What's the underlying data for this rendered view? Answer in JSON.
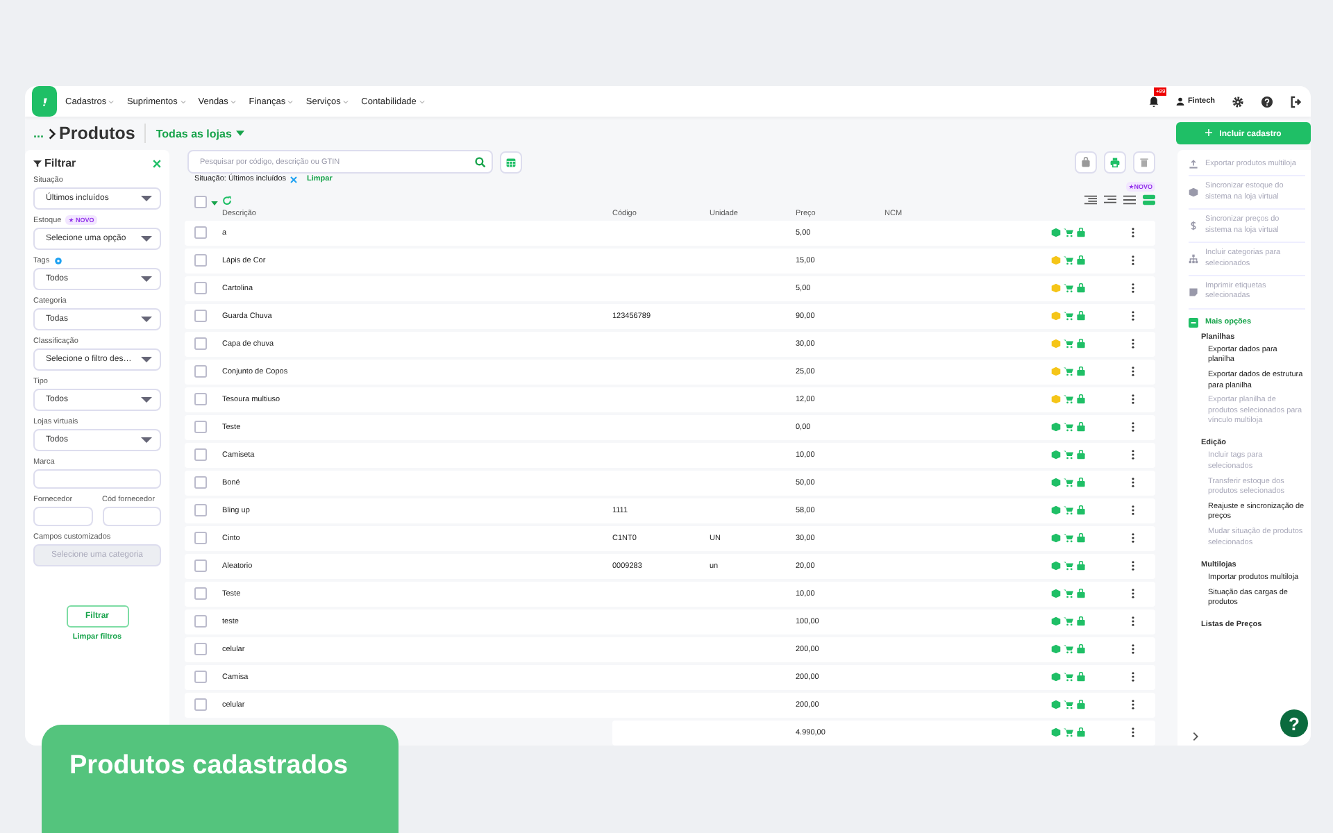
{
  "topbar": {
    "menu": [
      {
        "label": "Cadastros"
      },
      {
        "label": "Suprimentos"
      },
      {
        "label": "Vendas"
      },
      {
        "label": "Finanças"
      },
      {
        "label": "Serviços"
      },
      {
        "label": "Contabilidade"
      }
    ],
    "notifications": "+99",
    "user": "Fintech"
  },
  "breadcrumb": {
    "ellipsis": "...",
    "title": "Produtos",
    "store": "Todas as lojas"
  },
  "add_button": "Incluir cadastro",
  "filter": {
    "title": "Filtrar",
    "fields": [
      {
        "kind": "select",
        "label": "Situação",
        "value": "Últimos incluídos"
      },
      {
        "kind": "select",
        "label": "Estoque",
        "badge": "★ NOVO",
        "value": "Selecione uma opção"
      },
      {
        "kind": "select",
        "label": "Tags",
        "info": true,
        "value": "Todos"
      },
      {
        "kind": "select",
        "label": "Categoria",
        "value": "Todas"
      },
      {
        "kind": "select",
        "label": "Classificação",
        "value": "Selecione o filtro des…"
      },
      {
        "kind": "select",
        "label": "Tipo",
        "value": "Todos"
      },
      {
        "kind": "select",
        "label": "Lojas virtuais",
        "value": "Todos"
      },
      {
        "kind": "input",
        "label": "Marca"
      },
      {
        "kind": "pair",
        "fields": [
          {
            "label": "Fornecedor"
          },
          {
            "label": "Cód fornecedor"
          }
        ]
      },
      {
        "kind": "select",
        "label": "Campos customizados",
        "placeholder": "Selecione uma categoria",
        "disabled": true
      }
    ],
    "apply": "Filtrar",
    "clear": "Limpar filtros"
  },
  "search": {
    "placeholder": "Pesquisar por código, descrição ou GTIN"
  },
  "active_filter": {
    "label": "Situação: Últimos incluídos",
    "clear": "Limpar"
  },
  "select_all": {
    "checked": false
  },
  "view_badge": "★NOVO",
  "view_modes": [
    {
      "selected": false
    },
    {
      "selected": false
    },
    {
      "selected": false
    },
    {
      "selected": true
    }
  ],
  "table": {
    "columns": [
      "Descrição",
      "Código",
      "Unidade",
      "Preço",
      "NCM"
    ],
    "rows": [
      {
        "checked": false,
        "description": "a",
        "code": "",
        "unit": "",
        "price": "5,00",
        "color": "#1fbf66"
      },
      {
        "checked": false,
        "description": "Lápis de Cor",
        "code": "",
        "unit": "",
        "price": "15,00",
        "color": "#f5c518"
      },
      {
        "checked": false,
        "description": "Cartolina",
        "code": "",
        "unit": "",
        "price": "5,00",
        "color": "#f5c518"
      },
      {
        "checked": false,
        "description": "Guarda Chuva",
        "code": "123456789",
        "unit": "",
        "price": "90,00",
        "color": "#f5c518"
      },
      {
        "checked": false,
        "description": "Capa de chuva",
        "code": "",
        "unit": "",
        "price": "30,00",
        "color": "#f5c518"
      },
      {
        "checked": false,
        "description": "Conjunto de Copos",
        "code": "",
        "unit": "",
        "price": "25,00",
        "color": "#f5c518"
      },
      {
        "checked": false,
        "description": "Tesoura multiuso",
        "code": "",
        "unit": "",
        "price": "12,00",
        "color": "#f5c518"
      },
      {
        "checked": false,
        "description": "Teste",
        "code": "",
        "unit": "",
        "price": "0,00",
        "color": "#1fbf66"
      },
      {
        "checked": false,
        "description": "Camiseta",
        "code": "",
        "unit": "",
        "price": "10,00",
        "color": "#1fbf66"
      },
      {
        "checked": false,
        "description": "Boné",
        "code": "",
        "unit": "",
        "price": "50,00",
        "color": "#1fbf66"
      },
      {
        "checked": false,
        "description": "Bling up",
        "code": "1111",
        "unit": "",
        "price": "58,00",
        "color": "#1fbf66"
      },
      {
        "checked": false,
        "description": "Cinto",
        "code": "C1NT0",
        "unit": "UN",
        "price": "30,00",
        "color": "#1fbf66"
      },
      {
        "checked": false,
        "description": "Aleatorio",
        "code": "0009283",
        "unit": "un",
        "price": "20,00",
        "color": "#1fbf66"
      },
      {
        "checked": false,
        "description": "Teste",
        "code": "",
        "unit": "",
        "price": "10,00",
        "color": "#1fbf66"
      },
      {
        "checked": false,
        "description": "teste",
        "code": "",
        "unit": "",
        "price": "100,00",
        "color": "#1fbf66"
      },
      {
        "checked": false,
        "description": "celular",
        "code": "",
        "unit": "",
        "price": "200,00",
        "color": "#1fbf66"
      },
      {
        "checked": false,
        "description": "Camisa",
        "code": "",
        "unit": "",
        "price": "200,00",
        "color": "#1fbf66"
      },
      {
        "checked": false,
        "description": "celular",
        "code": "",
        "unit": "",
        "price": "200,00",
        "color": "#1fbf66"
      },
      {
        "description": "",
        "code": "",
        "unit": "",
        "price": "4.990,00",
        "color": "#1fbf66"
      }
    ]
  },
  "actions": [
    {
      "kind": "upload",
      "label": "Exportar produtos multiloja",
      "disabled": true
    },
    {
      "kind": "box",
      "label": "Sincronizar estoque do sistema na loja virtual",
      "disabled": true
    },
    {
      "kind": "dollar",
      "label": "Sincronizar preços do sistema na loja virtual",
      "disabled": true
    },
    {
      "kind": "tree",
      "label": "Incluir categorias para selecionados",
      "disabled": true
    },
    {
      "kind": "tag",
      "label": "Imprimir etiquetas selecionadas",
      "disabled": true
    }
  ],
  "more": {
    "label": "Mais opções",
    "expanded": true,
    "groups": [
      {
        "title": "Planilhas",
        "items": [
          {
            "label": "Exportar dados para planilha",
            "disabled": false
          },
          {
            "label": "Exportar dados de estrutura para planilha",
            "disabled": false
          },
          {
            "label": "Exportar planilha de produtos selecionados para vínculo multiloja",
            "disabled": true
          }
        ]
      },
      {
        "title": "Edição",
        "items": [
          {
            "label": "Incluir tags para selecionados",
            "disabled": true
          },
          {
            "label": "Transferir estoque dos produtos selecionados",
            "disabled": true
          },
          {
            "label": "Reajuste e sincronização de preços",
            "disabled": false
          },
          {
            "label": "Mudar situação de produtos selecionados",
            "disabled": true
          }
        ]
      },
      {
        "title": "Multilojas",
        "items": [
          {
            "label": "Importar produtos multiloja",
            "disabled": false
          },
          {
            "label": "Situação das cargas de produtos",
            "disabled": false
          }
        ]
      },
      {
        "title": "Listas de Preços"
      }
    ]
  },
  "help": "?",
  "caption": "Produtos cadastrados"
}
